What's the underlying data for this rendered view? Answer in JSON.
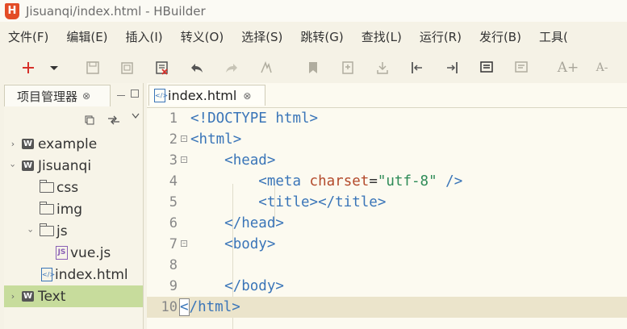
{
  "window": {
    "title": "Jisuanqi/index.html  -  HBuilder",
    "logo": "H"
  },
  "menu": [
    {
      "label": "文件(F)"
    },
    {
      "label": "编辑(E)"
    },
    {
      "label": "插入(I)"
    },
    {
      "label": "转义(O)"
    },
    {
      "label": "选择(S)"
    },
    {
      "label": "跳转(G)"
    },
    {
      "label": "查找(L)"
    },
    {
      "label": "运行(R)"
    },
    {
      "label": "发行(B)"
    },
    {
      "label": "工具("
    }
  ],
  "toolbar": {
    "new_icon": "plus-icon",
    "font_increase": "A+",
    "font_decrease": "A-"
  },
  "project_panel": {
    "tab_label": "项目管理器",
    "close_glyph": "⊗",
    "tree": [
      {
        "label": "example",
        "type": "project",
        "expanded": false,
        "depth": 0
      },
      {
        "label": "Jisuanqi",
        "type": "project",
        "expanded": true,
        "depth": 0
      },
      {
        "label": "css",
        "type": "folder",
        "depth": 1
      },
      {
        "label": "img",
        "type": "folder",
        "depth": 1
      },
      {
        "label": "js",
        "type": "folder",
        "expanded": true,
        "depth": 1
      },
      {
        "label": "vue.js",
        "type": "js",
        "depth": 2
      },
      {
        "label": "index.html",
        "type": "html",
        "depth": 1
      },
      {
        "label": "Text",
        "type": "project",
        "expanded": false,
        "depth": 0,
        "selected": true
      }
    ]
  },
  "editor": {
    "tab_label": "index.html",
    "close_glyph": "⊗",
    "lines": [
      {
        "num": "1",
        "text": "<!DOCTYPE html>"
      },
      {
        "num": "2",
        "text": "<html>"
      },
      {
        "num": "3",
        "text": "    <head>"
      },
      {
        "num": "4",
        "text": "        <meta charset=\"utf-8\" />"
      },
      {
        "num": "5",
        "text": "        <title></title>"
      },
      {
        "num": "6",
        "text": "    </head>"
      },
      {
        "num": "7",
        "text": "    <body>"
      },
      {
        "num": "8",
        "text": ""
      },
      {
        "num": "9",
        "text": "    </body>"
      },
      {
        "num": "10",
        "text": "</html>"
      }
    ],
    "code": {
      "l1": "!DOCTYPE html",
      "l2": "html",
      "l3": "head",
      "l4_tag": "meta",
      "l4_attr": "charset",
      "l4_val": "\"utf-8\"",
      "l5_open": "title",
      "l5_close": "/title",
      "l6": "/head",
      "l7": "body",
      "l9": "/body",
      "l10": "/html"
    }
  }
}
